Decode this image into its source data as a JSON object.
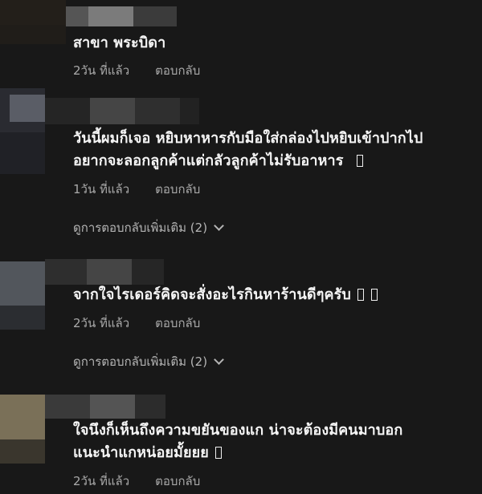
{
  "comments": [
    {
      "text": "สาขา พระบิดา",
      "time": "2วัน ที่แล้ว",
      "reply": "ตอบกลับ",
      "trailing_boxes": 0
    },
    {
      "text_line1": "วันนี้ผมก็เจอ หยิบหาหารกับมือใส่กล่องไปหยิบเข้าปากไป",
      "text_line2": "อยากจะลอกลูกค้าแต่กลัวลูกค้าไม่รับอาหาร",
      "time": "1วัน ที่แล้ว",
      "reply": "ตอบกลับ",
      "more_replies": "ดูการตอบกลับเพิ่มเติม (2)",
      "trailing_boxes": 1
    },
    {
      "text": "จากใจไรเดอร์คิดจะสั่งอะไรกินหาร้านดีๆครับ",
      "time": "2วัน ที่แล้ว",
      "reply": "ตอบกลับ",
      "more_replies": "ดูการตอบกลับเพิ่มเติม (2)",
      "trailing_boxes": 2
    },
    {
      "text_line1": "ใจนึงก็เห็นถึงความขยันของแก น่าจะต้องมีคนมาบอก",
      "text_line2": "แนะนำแกหน่อยมั้ยยย",
      "time": "2วัน ที่แล้ว",
      "reply": "ตอบกลับ",
      "trailing_boxes": 1
    }
  ],
  "colors": {
    "background": "#181818",
    "comment_text": "#f5f5f5",
    "meta_text": "#a9a9a9",
    "more_replies_text": "#b5b5b5"
  },
  "icons": {
    "more_replies": "chevron-down-icon"
  }
}
